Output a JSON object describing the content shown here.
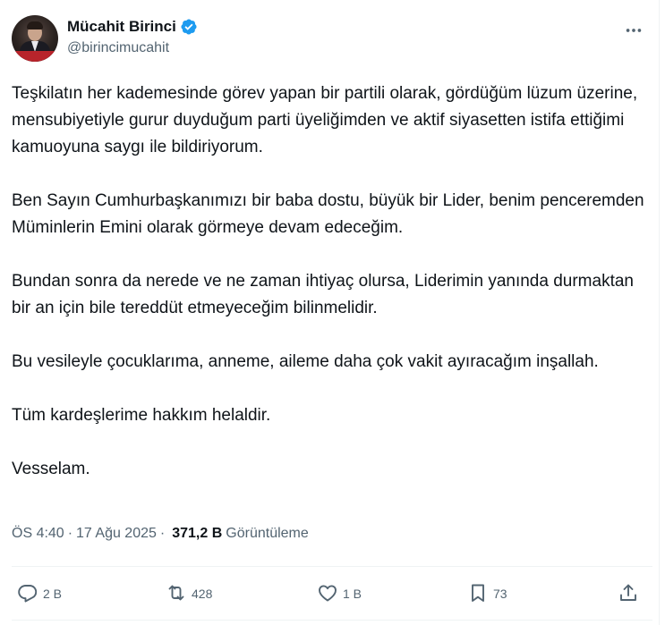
{
  "author": {
    "display_name": "Mücahit Birinci",
    "handle": "@birincimucahit"
  },
  "tweet": {
    "paragraphs": [
      "Teşkilatın her kademesinde görev yapan bir partili olarak, gördüğüm lüzum üzerine, mensubiyetiyle gurur duyduğum parti üyeliğimden ve aktif siyasetten istifa ettiğimi kamuoyuna saygı ile bildiriyorum.",
      "Ben Sayın Cumhurbaşkanımızı bir baba dostu, büyük bir Lider, benim penceremden Müminlerin Emini olarak görmeye devam edeceğim.",
      "Bundan sonra da nerede ve ne zaman ihtiyaç olursa, Liderimin yanında durmaktan bir an için bile tereddüt etmeyeceğim bilinmelidir.",
      "Bu vesileyle çocuklarıma, anneme, aileme daha çok vakit ayıracağım inşallah.",
      "Tüm kardeşlerime hakkım helaldir.",
      "Vesselam."
    ]
  },
  "meta": {
    "time": "ÖS 4:40",
    "separator": "·",
    "date": "17 Ağu 2025",
    "views_count": "371,2 B",
    "views_label": "Görüntüleme"
  },
  "actions": {
    "replies": "2 B",
    "reposts": "428",
    "likes": "1 B",
    "bookmarks": "73"
  },
  "colors": {
    "verified": "#1d9bf0",
    "text": "#0f1419",
    "secondary": "#536471",
    "divider": "#eff3f4"
  },
  "icons": [
    "verified-badge-icon",
    "more-icon",
    "reply-icon",
    "repost-icon",
    "like-icon",
    "bookmark-icon",
    "share-icon"
  ]
}
